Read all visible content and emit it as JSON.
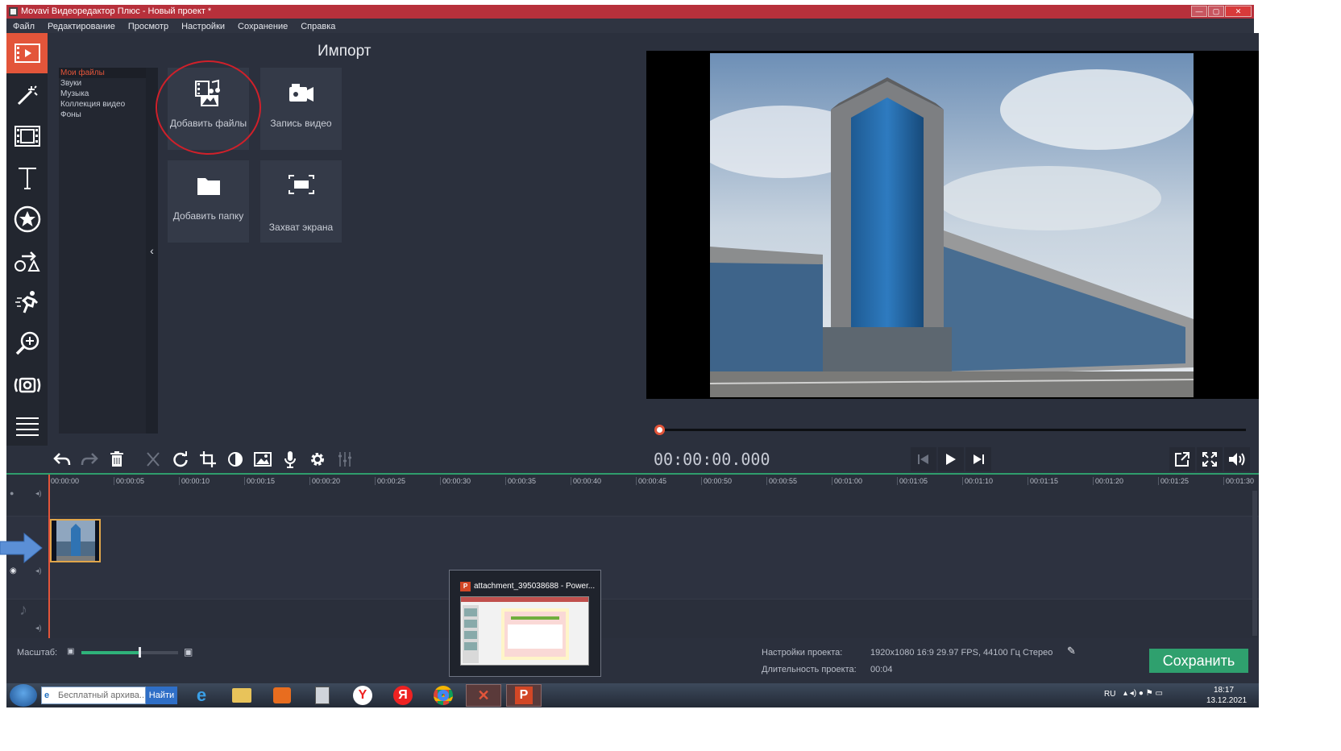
{
  "window": {
    "title": "Movavi Видеоредактор Плюс - Новый проект *"
  },
  "menu": [
    "Файл",
    "Редактирование",
    "Просмотр",
    "Настройки",
    "Сохранение",
    "Справка"
  ],
  "sidebar_tools": [
    "import-icon",
    "magic-wand-icon",
    "film-transitions-icon",
    "text-icon",
    "star-stickers-icon",
    "shapes-icon",
    "motion-icon",
    "zoom-icon",
    "stabilization-icon",
    "list-icon"
  ],
  "import": {
    "title": "Импорт",
    "categories": [
      "Мои файлы",
      "Звуки",
      "Музыка",
      "Коллекция видео",
      "Фоны"
    ],
    "tiles": {
      "add_files": "Добавить файлы",
      "record_video": "Запись видео",
      "add_folder": "Добавить папку",
      "screen_capture": "Захват экрана"
    }
  },
  "player": {
    "timecode": "00:00:00.000",
    "position": 0.0
  },
  "timeline": {
    "ticks": [
      "00:00:00",
      "00:00:05",
      "00:00:10",
      "00:00:15",
      "00:00:20",
      "00:00:25",
      "00:00:30",
      "00:00:35",
      "00:00:40",
      "00:00:45",
      "00:00:50",
      "00:00:55",
      "00:01:00",
      "00:01:05",
      "00:01:10",
      "00:01:15",
      "00:01:20",
      "00:01:25",
      "00:01:30"
    ]
  },
  "popup": {
    "title": "attachment_395038688 - Power..."
  },
  "status": {
    "scale_label": "Масштаб:",
    "scale_level": 0.6,
    "project_settings_label": "Настройки проекта:",
    "project_settings_value": "1920x1080 16:9 29.97 FPS, 44100 Гц Стерео",
    "duration_label": "Длительность проекта:",
    "duration_value": "00:04",
    "save_button": "Сохранить"
  },
  "taskbar": {
    "search_placeholder": "Бесплатный архива...",
    "search_button": "Найти",
    "lang": "RU",
    "time": "18:17",
    "date": "13.12.2021"
  },
  "colors": {
    "accent": "#e3553a",
    "save": "#2fa06e",
    "title": "#b7303b"
  }
}
